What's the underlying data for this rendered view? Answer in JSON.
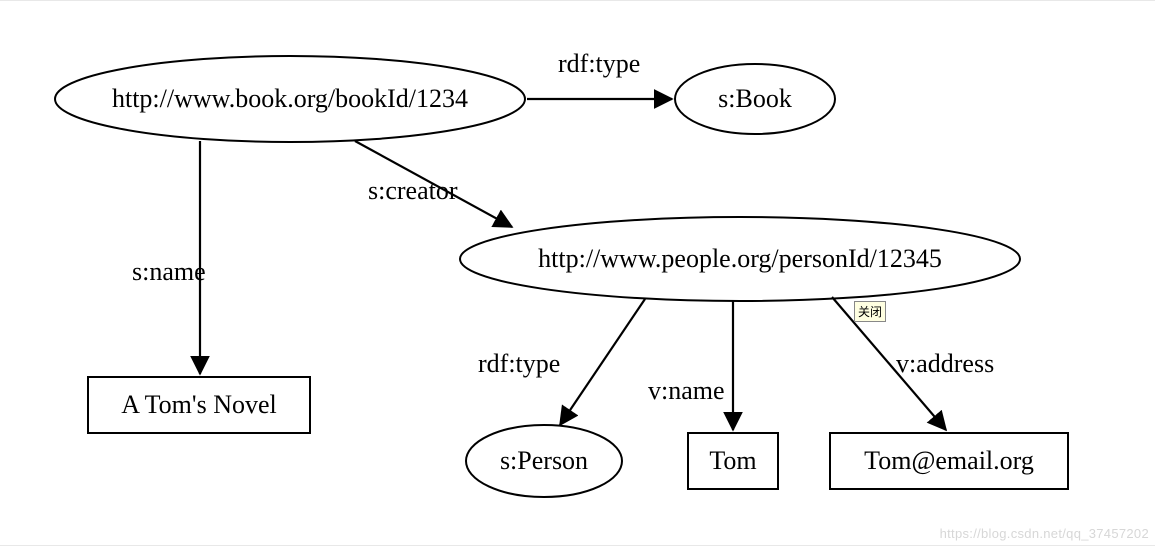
{
  "nodes": {
    "book_uri": {
      "label": "http://www.book.org/bookId/1234"
    },
    "s_book": {
      "label": "s:Book"
    },
    "person_uri": {
      "label": "http://www.people.org/personId/12345"
    },
    "s_person": {
      "label": "s:Person"
    },
    "novel": {
      "label": "A Tom's Novel"
    },
    "tom": {
      "label": "Tom"
    },
    "email": {
      "label": "Tom@email.org"
    }
  },
  "edges": {
    "rdf_type_book": {
      "label": "rdf:type"
    },
    "s_name": {
      "label": "s:name"
    },
    "s_creator": {
      "label": "s:creator"
    },
    "rdf_type_person": {
      "label": "rdf:type"
    },
    "v_name": {
      "label": "v:name"
    },
    "v_address": {
      "label": "v:address"
    }
  },
  "tooltip": {
    "label": "关闭"
  },
  "watermark": {
    "label": "https://blog.csdn.net/qq_37457202"
  }
}
